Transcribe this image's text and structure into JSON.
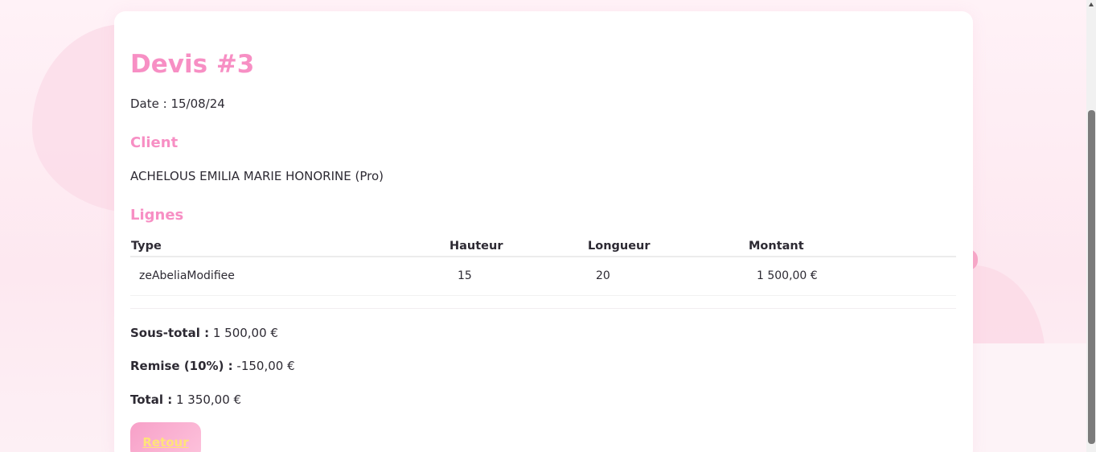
{
  "quote": {
    "title": "Devis #3",
    "date_label": "Date : ",
    "date_value": "15/08/24"
  },
  "client": {
    "heading": "Client",
    "name": "ACHELOUS EMILIA MARIE HONORINE (Pro)"
  },
  "lines": {
    "heading": "Lignes",
    "columns": [
      "Type",
      "Hauteur",
      "Longueur",
      "Montant"
    ],
    "rows": [
      [
        "zeAbeliaModifiee",
        "15",
        "20",
        "1 500,00 €"
      ]
    ]
  },
  "totals": {
    "subtotal_label": "Sous-total :",
    "subtotal_value": " 1 500,00 €",
    "discount_label": "Remise (10%) :",
    "discount_value": " -150,00 €",
    "total_label": "Total :",
    "total_value": " 1 350,00 €"
  },
  "actions": {
    "back_label": "Retour"
  },
  "colors": {
    "accent": "#f78fc4",
    "button_text": "#ffe37a"
  }
}
